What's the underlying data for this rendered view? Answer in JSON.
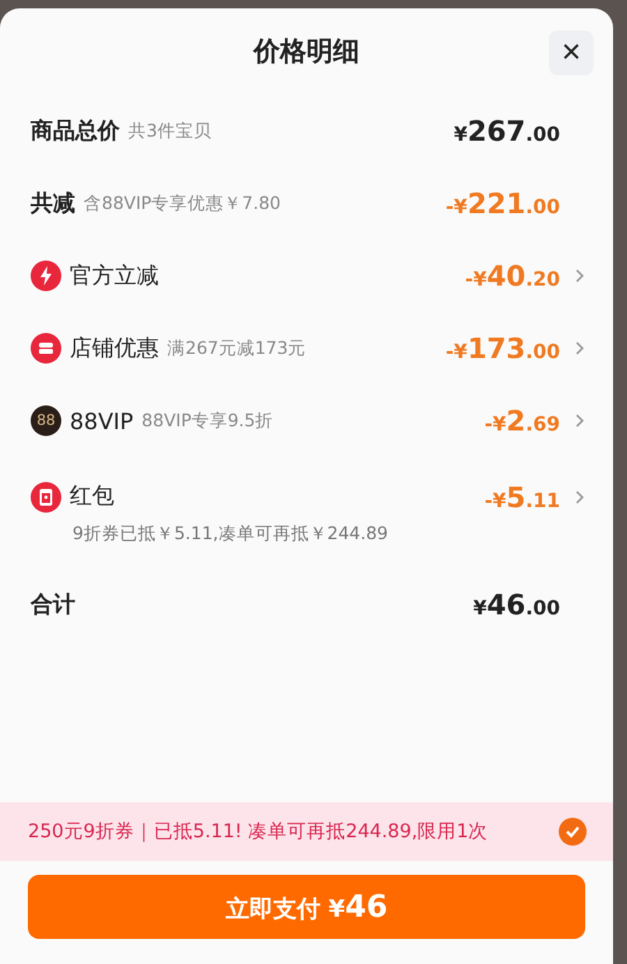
{
  "title": "价格明细",
  "close": "×",
  "rows": [
    {
      "kind": "summary",
      "label": "商品总价",
      "note": "共3件宝贝",
      "price": {
        "prefix": "¥",
        "integer": "267",
        "decimal": ".00"
      },
      "accent": false
    },
    {
      "kind": "summary",
      "label": "共减",
      "note": "含88VIP专享优惠￥7.80",
      "price": {
        "prefix": "-¥",
        "integer": "221",
        "decimal": ".00"
      },
      "accent": true
    },
    {
      "kind": "official",
      "label": "官方立减",
      "price": {
        "prefix": "-¥",
        "integer": "40",
        "decimal": ".20"
      },
      "accent": true
    },
    {
      "kind": "store",
      "label": "店铺优惠",
      "note": "满267元减173元",
      "price": {
        "prefix": "-¥",
        "integer": "173",
        "decimal": ".00"
      },
      "accent": true
    },
    {
      "kind": "vip",
      "icon_text": "88",
      "label": "88VIP",
      "note": "88VIP专享9.5折",
      "price": {
        "prefix": "-¥",
        "integer": "2",
        "decimal": ".69"
      },
      "accent": true
    },
    {
      "kind": "packet",
      "label": "红包",
      "sub": "9折券已抵￥5.11,凑单可再抵￥244.89",
      "price": {
        "prefix": "-¥",
        "integer": "5",
        "decimal": ".11"
      },
      "accent": true
    },
    {
      "kind": "summary",
      "label": "合计",
      "price": {
        "prefix": "¥",
        "integer": "46",
        "decimal": ".00"
      },
      "accent": false
    }
  ],
  "coupon": {
    "text": "250元9折券｜已抵5.11! 凑单可再抵244.89,限用1次",
    "checked": true
  },
  "pay": {
    "label": "立即支付",
    "prefix": "¥",
    "amount": "46"
  }
}
